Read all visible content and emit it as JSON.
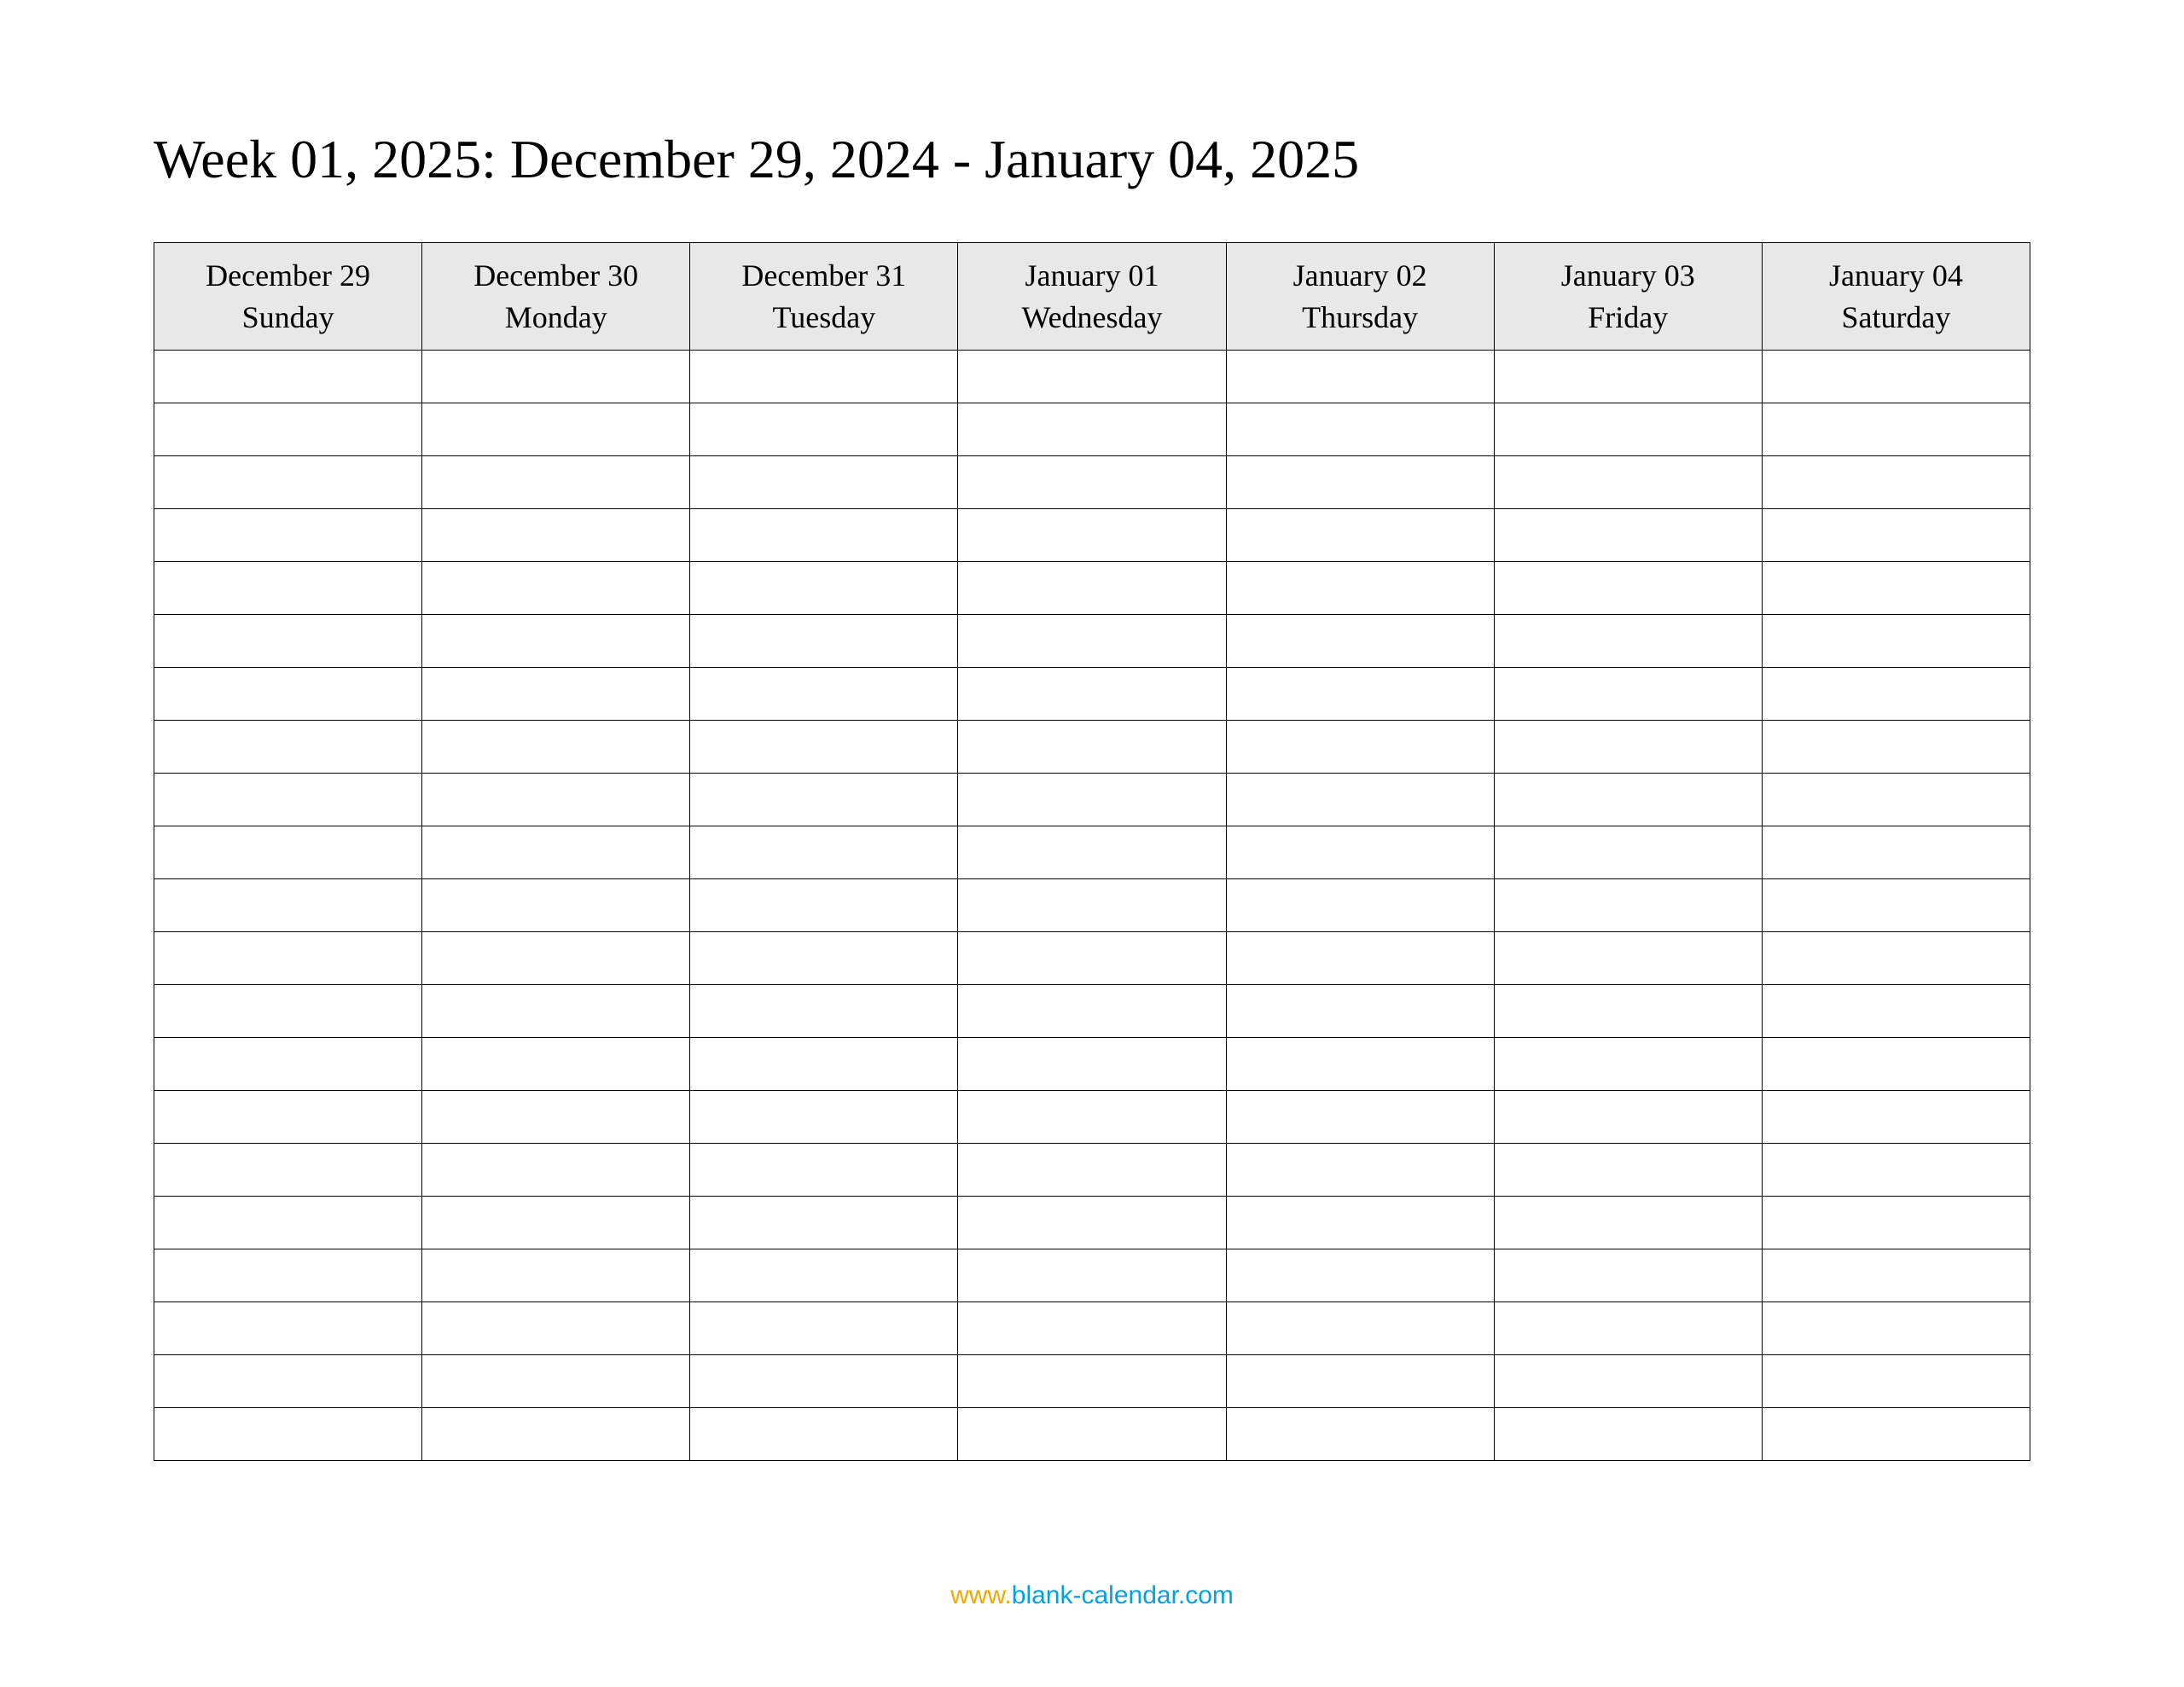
{
  "title": "Week 01, 2025: December 29, 2024 - January 04, 2025",
  "columns": [
    {
      "date": "December 29",
      "day": "Sunday"
    },
    {
      "date": "December 30",
      "day": "Monday"
    },
    {
      "date": "December 31",
      "day": "Tuesday"
    },
    {
      "date": "January 01",
      "day": "Wednesday"
    },
    {
      "date": "January 02",
      "day": "Thursday"
    },
    {
      "date": "January 03",
      "day": "Friday"
    },
    {
      "date": "January 04",
      "day": "Saturday"
    }
  ],
  "blank_row_count": 21,
  "footer": {
    "www": "www.",
    "host": "blank-calendar.com"
  }
}
